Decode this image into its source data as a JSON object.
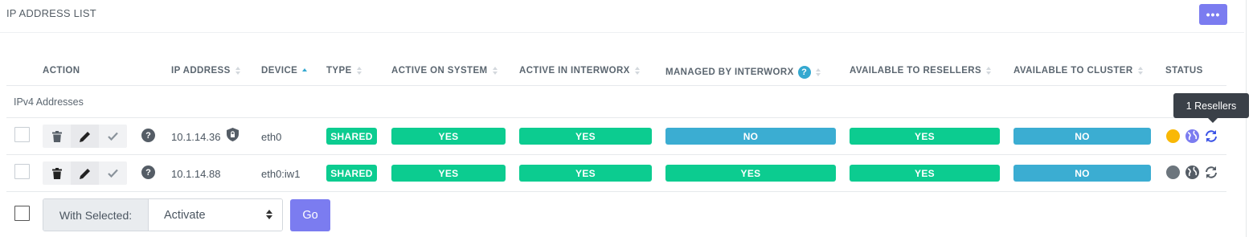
{
  "panel": {
    "title": "IP ADDRESS LIST",
    "menu_label": "•••"
  },
  "columns": [
    {
      "key": "action",
      "label": "ACTION",
      "sort": "none"
    },
    {
      "key": "ip",
      "label": "IP ADDRESS",
      "sort": "both"
    },
    {
      "key": "device",
      "label": "DEVICE",
      "sort": "asc"
    },
    {
      "key": "type",
      "label": "TYPE",
      "sort": "both"
    },
    {
      "key": "active_system",
      "label": "ACTIVE ON SYSTEM",
      "sort": "both"
    },
    {
      "key": "active_interworx",
      "label": "ACTIVE IN INTERWORX",
      "sort": "both"
    },
    {
      "key": "managed",
      "label": "MANAGED BY INTERWORX",
      "sort": "both",
      "help": "?"
    },
    {
      "key": "resellers",
      "label": "AVAILABLE TO RESELLERS",
      "sort": "both"
    },
    {
      "key": "cluster",
      "label": "AVAILABLE TO CLUSTER",
      "sort": "both"
    },
    {
      "key": "status",
      "label": "STATUS",
      "sort": "none"
    }
  ],
  "group_label": "IPv4 Addresses",
  "rows": [
    {
      "ip": "10.1.14.36",
      "ip_badge": "shield-lock-icon",
      "device": "eth0",
      "type": "SHARED",
      "active_system": "YES",
      "active_interworx": "YES",
      "managed": "NO",
      "resellers": "YES",
      "cluster": "NO",
      "status_dot_color": "#f9b806",
      "globe_color": "#7b7cf0",
      "sync_color": "#3a52e6"
    },
    {
      "ip": "10.1.14.88",
      "ip_badge": "",
      "device": "eth0:iw1",
      "type": "SHARED",
      "active_system": "YES",
      "active_interworx": "YES",
      "managed": "YES",
      "resellers": "YES",
      "cluster": "NO",
      "status_dot_color": "#6c757d",
      "globe_color": "#555d66",
      "sync_color": "#555d66"
    }
  ],
  "tooltip": "1 Resellers",
  "bulk": {
    "label": "With Selected:",
    "selected_action": "Activate",
    "go_label": "Go"
  },
  "colors": {
    "accent": "#7b7cf0",
    "yes": "#0ccc90",
    "no": "#3badd2"
  }
}
